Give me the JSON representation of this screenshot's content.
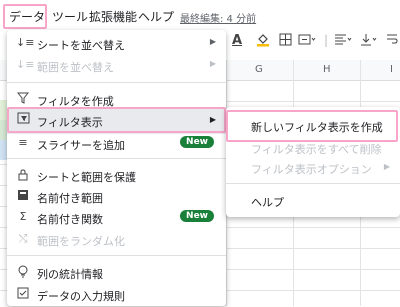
{
  "menubar": {
    "items": [
      "データ",
      "ツール",
      "拡張機能",
      "ヘルプ"
    ],
    "last_edit": "最終編集: 4 分前"
  },
  "toolbar": {
    "font_color": "A",
    "fill_icon": "paint-bucket-icon",
    "borders_icon": "borders-icon",
    "merge_icon": "merge-cells-icon",
    "halign_icon": "align-left-icon",
    "valign_icon": "align-bottom-icon"
  },
  "grid": {
    "columns": [
      "G",
      "H",
      "I"
    ]
  },
  "data_menu": {
    "items": [
      {
        "label": "シートを並べ替え",
        "icon": "sort-icon",
        "submenu": true,
        "disabled": false
      },
      {
        "label": "範囲を並べ替え",
        "icon": "sort-icon",
        "submenu": true,
        "disabled": true
      },
      {
        "label": "フィルタを作成",
        "icon": "filter-icon",
        "submenu": false,
        "disabled": false
      },
      {
        "label": "フィルタ表示",
        "icon": "filter-views-icon",
        "submenu": true,
        "disabled": false
      },
      {
        "label": "スライサーを追加",
        "icon": "slicer-icon",
        "badge": "New",
        "disabled": false
      },
      {
        "label": "シートと範囲を保護",
        "icon": "lock-icon",
        "disabled": false
      },
      {
        "label": "名前付き範囲",
        "icon": "named-range-icon",
        "disabled": false
      },
      {
        "label": "名前付き関数",
        "icon": "sigma-icon",
        "badge": "New",
        "disabled": false
      },
      {
        "label": "範囲をランダム化",
        "icon": "shuffle-icon",
        "disabled": true
      },
      {
        "label": "列の統計情報",
        "icon": "lightbulb-icon",
        "disabled": false
      },
      {
        "label": "データの入力規則",
        "icon": "validation-icon",
        "disabled": false
      }
    ]
  },
  "submenu": {
    "items": [
      {
        "label": "新しいフィルタ表示を作成",
        "disabled": false
      },
      {
        "label": "フィルタ表示をすべて削除",
        "disabled": true
      },
      {
        "label": "フィルタ表示オプション",
        "disabled": true,
        "submenu": true
      },
      {
        "label": "ヘルプ",
        "disabled": false
      }
    ]
  }
}
